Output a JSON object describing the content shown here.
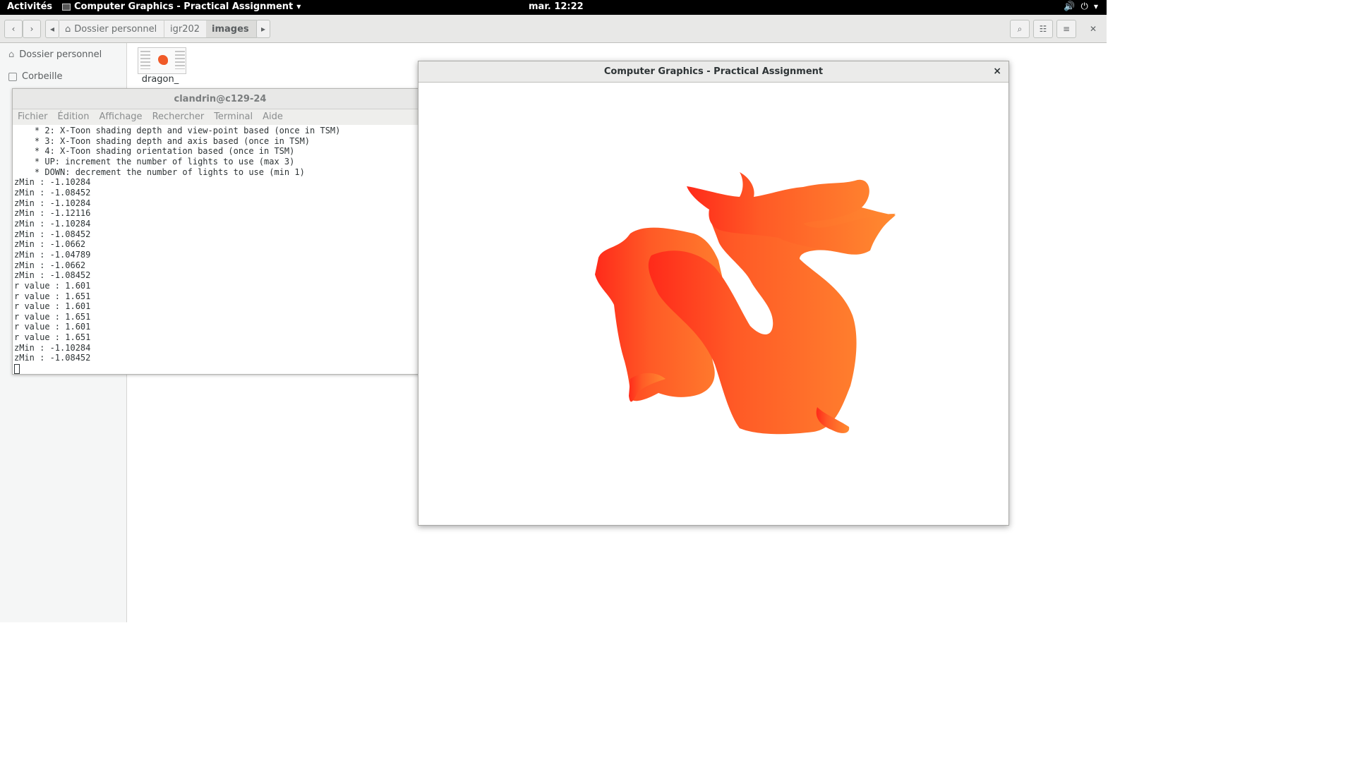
{
  "topbar": {
    "activities": "Activités",
    "app_menu": "Computer Graphics - Practical Assignment",
    "clock": "mar. 12:22"
  },
  "files": {
    "breadcrumbs": [
      "Dossier personnel",
      "igr202",
      "images"
    ],
    "sidebar": [
      "Dossier personnel",
      "Corbeille"
    ],
    "file_name": "dragon_"
  },
  "terminal": {
    "title": "clandrin@c129-24",
    "menu": [
      "Fichier",
      "Édition",
      "Affichage",
      "Rechercher",
      "Terminal",
      "Aide"
    ],
    "lines": [
      "    * 2: X-Toon shading depth and view-point based (once in TSM)",
      "    * 3: X-Toon shading depth and axis based (once in TSM)",
      "    * 4: X-Toon shading orientation based (once in TSM)",
      "    * UP: increment the number of lights to use (max 3)",
      "    * DOWN: decrement the number of lights to use (min 1)",
      "zMin : -1.10284",
      "zMin : -1.08452",
      "zMin : -1.10284",
      "zMin : -1.12116",
      "zMin : -1.10284",
      "zMin : -1.08452",
      "zMin : -1.0662",
      "zMin : -1.04789",
      "zMin : -1.0662",
      "zMin : -1.08452",
      "r value : 1.601",
      "r value : 1.651",
      "r value : 1.601",
      "r value : 1.651",
      "r value : 1.601",
      "r value : 1.651",
      "zMin : -1.10284",
      "zMin : -1.08452"
    ]
  },
  "gl_window": {
    "title": "Computer Graphics - Practical Assignment",
    "close": "×",
    "colors": {
      "red": "#ff2a1a",
      "orange": "#ff8a30"
    }
  }
}
